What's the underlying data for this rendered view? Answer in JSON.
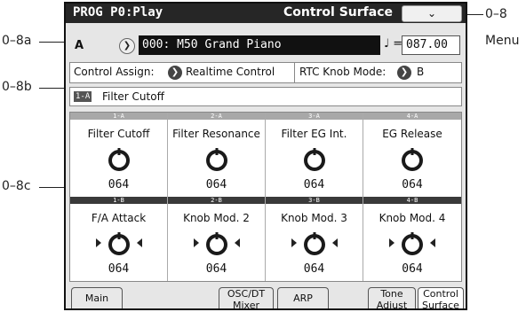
{
  "callouts": {
    "menu_ref": "0–8",
    "menu_word": "Menu",
    "ref_a": "0–8a",
    "ref_b": "0–8b",
    "ref_c": "0–8c"
  },
  "titlebar": {
    "mode": "PROG P0:Play",
    "page": "Control Surface",
    "menu_glyph": "⌄"
  },
  "program": {
    "bank": "A",
    "name": "000: M50 Grand Piano",
    "tempo_symbol": "♩ =",
    "tempo": "087.00"
  },
  "assign": {
    "label": "Control Assign:",
    "value": "Realtime Control",
    "rtc_label": "RTC Knob Mode:",
    "rtc_value": "B"
  },
  "selected": {
    "tag": "1-A",
    "label": "Filter Cutoff"
  },
  "knobs_top": [
    {
      "id": "1-A",
      "name": "Filter Cutoff",
      "value": "064"
    },
    {
      "id": "2-A",
      "name": "Filter Resonance",
      "value": "064"
    },
    {
      "id": "3-A",
      "name": "Filter EG Int.",
      "value": "064"
    },
    {
      "id": "4-A",
      "name": "EG Release",
      "value": "064"
    }
  ],
  "knobs_bottom": [
    {
      "id": "1-B",
      "name": "F/A Attack",
      "value": "064"
    },
    {
      "id": "2-B",
      "name": "Knob Mod. 2",
      "value": "064"
    },
    {
      "id": "3-B",
      "name": "Knob Mod. 3",
      "value": "064"
    },
    {
      "id": "4-B",
      "name": "Knob Mod. 4",
      "value": "064"
    }
  ],
  "tabs": [
    {
      "line1": "Main",
      "line2": ""
    },
    {
      "line1": "OSC/DT",
      "line2": "Mixer"
    },
    {
      "line1": "ARP",
      "line2": ""
    },
    {
      "line1": "Tone",
      "line2": "Adjust"
    },
    {
      "line1": "Control",
      "line2": "Surface"
    }
  ],
  "colors": {
    "header_top": "#a8a8a8",
    "header_bottom": "#3a3a3a"
  }
}
